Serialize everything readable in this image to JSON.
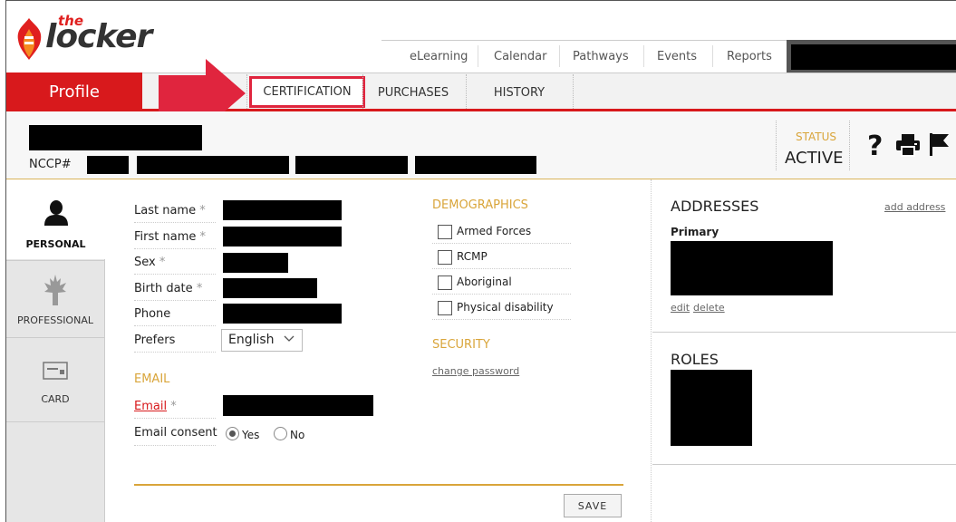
{
  "logo": {
    "the": "the",
    "locker": "locker"
  },
  "top_nav": [
    "eLearning",
    "Calendar",
    "Pathways",
    "Events",
    "Reports"
  ],
  "profile_tab": "Profile",
  "tabs": {
    "certification": "CERTIFICATION",
    "purchases": "PURCHASES",
    "history": "HISTORY"
  },
  "header": {
    "nccp_label": "NCCP#",
    "status_label": "STATUS",
    "status_value": "ACTIVE",
    "help_glyph": "?"
  },
  "sidebar": [
    {
      "label": "PERSONAL",
      "icon": "person-icon",
      "active": true
    },
    {
      "label": "PROFESSIONAL",
      "icon": "maple-leaf-icon",
      "active": false
    },
    {
      "label": "CARD",
      "icon": "card-icon",
      "active": false
    }
  ],
  "personal": {
    "last_name": "Last name",
    "first_name": "First name",
    "sex": "Sex",
    "birth_date": "Birth date",
    "phone": "Phone",
    "prefers": "Prefers",
    "prefers_value": "English",
    "required_mark": "*"
  },
  "email": {
    "section": "EMAIL",
    "label": "Email",
    "consent": "Email consent",
    "yes": "Yes",
    "no": "No",
    "selected": "Yes"
  },
  "demographics": {
    "title": "DEMOGRAPHICS",
    "items": [
      "Armed Forces",
      "RCMP",
      "Aboriginal",
      "Physical disability"
    ]
  },
  "security": {
    "title": "SECURITY",
    "change_password": "change password"
  },
  "addresses": {
    "title": "ADDRESSES",
    "add": "add address",
    "primary": "Primary",
    "edit": "edit",
    "delete": "delete"
  },
  "roles": {
    "title": "ROLES"
  },
  "save_label": "SAVE",
  "colors": {
    "brand_red": "#d8191c",
    "accent_gold": "#d9a53a",
    "highlight": "#e0253e"
  }
}
